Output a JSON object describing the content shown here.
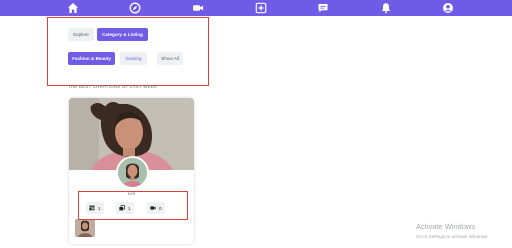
{
  "nav": {
    "icons": [
      "home-icon",
      "explore-compass-icon",
      "video-camera-icon",
      "add-post-icon",
      "messages-icon",
      "notifications-bell-icon",
      "profile-icon"
    ],
    "background": "#6f5ce6"
  },
  "filters": {
    "tabs": [
      {
        "label": "Explore",
        "active": false
      },
      {
        "label": "Category & Listing",
        "active": true
      }
    ],
    "categories": [
      {
        "label": "Fashion & Beauty",
        "active": true
      },
      {
        "label": "Gaming",
        "active": false
      },
      {
        "label": "Show All",
        "active": false
      }
    ]
  },
  "section": {
    "heading": "THE BEST CREATIONS OF LAST WEEK"
  },
  "creator": {
    "name": "Ela",
    "stats": [
      {
        "icon": "posts-icon",
        "value": "1"
      },
      {
        "icon": "collection-icon",
        "value": "1"
      },
      {
        "icon": "videos-icon",
        "value": "0"
      }
    ]
  },
  "watermark": {
    "title": "Activate Windows",
    "subtitle": "Go to Settings to activate Windows."
  },
  "colors": {
    "accent": "#6f5ce6",
    "annotation": "#e0403a"
  }
}
